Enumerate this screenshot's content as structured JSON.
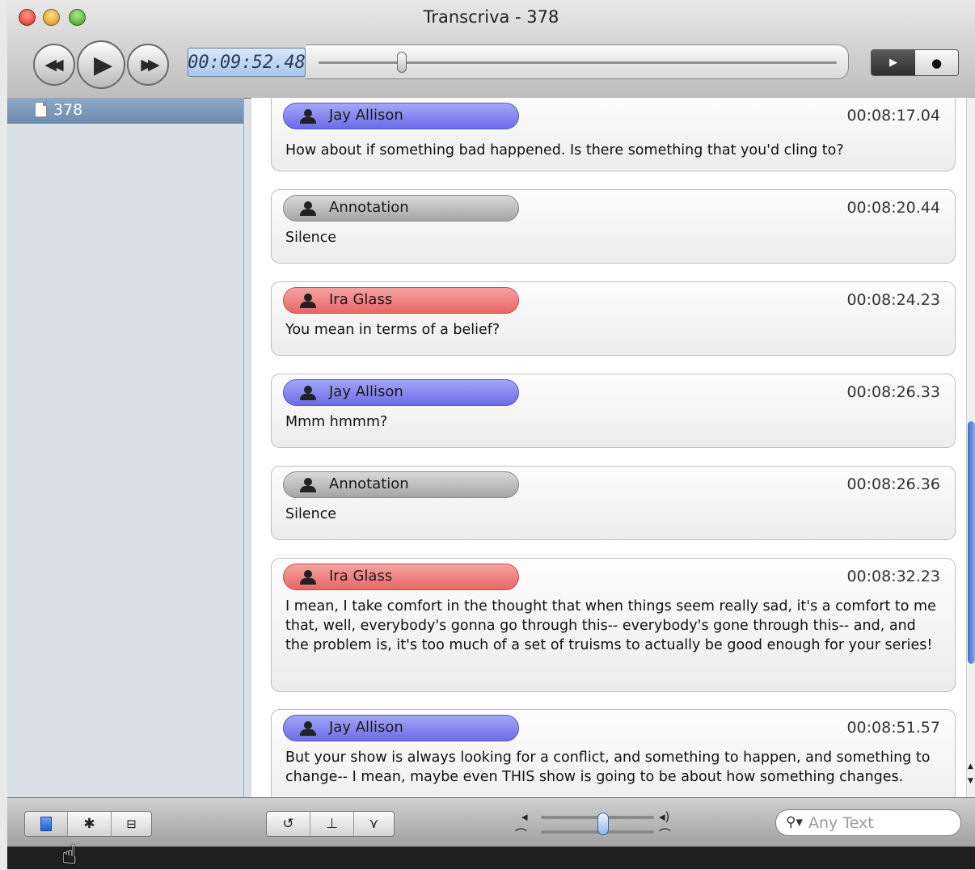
{
  "window": {
    "title": "Transcriva - 378"
  },
  "transport": {
    "time_display": "00:09:52.48",
    "scrub_position": 0.16,
    "mode_play_icon": "play-icon",
    "mode_record_icon": "record-icon"
  },
  "sidebar": {
    "items": [
      {
        "label": "378",
        "icon": "document-icon",
        "selected": true
      }
    ]
  },
  "transcript": {
    "entries": [
      {
        "speaker": "Jay Allison",
        "color": "#7173ec",
        "time": "00:08:17.04",
        "text": "How about if something bad happened. Is there something that you'd cling to?"
      },
      {
        "speaker": "Annotation",
        "color": "#b2b2b2",
        "time": "00:08:20.44",
        "text": "Silence"
      },
      {
        "speaker": "Ira Glass",
        "color": "#ee7070",
        "time": "00:08:24.23",
        "text": "You mean in terms of a belief?"
      },
      {
        "speaker": "Jay Allison",
        "color": "#7173ec",
        "time": "00:08:26.33",
        "text": "Mmm hmmm?"
      },
      {
        "speaker": "Annotation",
        "color": "#b2b2b2",
        "time": "00:08:26.36",
        "text": "Silence"
      },
      {
        "speaker": "Ira Glass",
        "color": "#ee7070",
        "time": "00:08:32.23",
        "text": "I mean, I take comfort in the thought that when things seem really sad, it's a comfort to me that, well, everybody's gonna go through this-- everybody's gone through this-- and, and the problem is, it's too much of a set of truisms to actually be good enough for your series!"
      },
      {
        "speaker": "Jay Allison",
        "color": "#7173ec",
        "time": "00:08:51.57",
        "text": "But your show is always looking for a conflict, and something to happen, and something to change-- I mean, maybe even THIS show is going to be about how something changes."
      }
    ]
  },
  "bottombar": {
    "view_buttons": [
      "document-icon",
      "gear-icon",
      "presentation-icon"
    ],
    "edit_buttons": [
      "loop-icon",
      "split-icon",
      "merge-icon"
    ],
    "volume_level": 0.55,
    "search_placeholder": "Any Text"
  }
}
